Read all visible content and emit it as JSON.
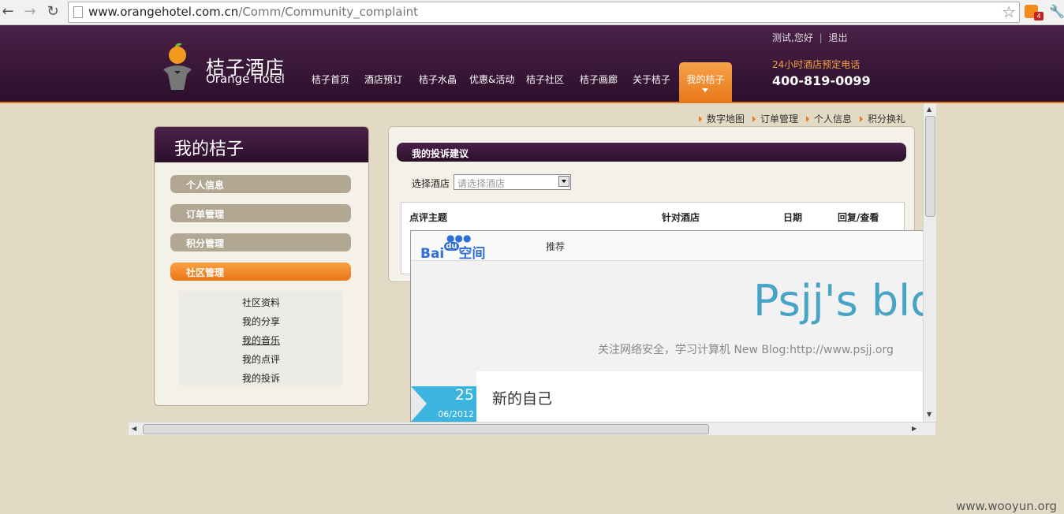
{
  "browser": {
    "url_domain": "www.orangehotel.com.cn",
    "url_path": "/Comm/Community_complaint",
    "rss_count": "4"
  },
  "header": {
    "logo_cn": "桔子酒店",
    "logo_en": "Orange Hotel",
    "nav": [
      "桔子首页",
      "酒店预订",
      "桔子水晶",
      "优惠&活动",
      "桔子社区",
      "桔子画廊",
      "关于桔子"
    ],
    "nav_active": "我的桔子",
    "user_greeting": "测试,您好",
    "logout": "退出",
    "hotline_label": "24小时酒店预定电话",
    "hotline": "400-819-0099"
  },
  "breadcrumbs": [
    "数字地图",
    "订单管理",
    "个人信息",
    "积分换礼"
  ],
  "sidebar": {
    "title": "我的桔子",
    "buttons": [
      "个人信息",
      "订单管理",
      "积分管理",
      "社区管理"
    ],
    "submenu": [
      "社区资料",
      "我的分享",
      "我的音乐",
      "我的点评",
      "我的投诉"
    ]
  },
  "main": {
    "title": "我的投诉建议",
    "hotel_label": "选择酒店",
    "hotel_placeholder": "请选择酒店",
    "columns": [
      "点评主题",
      "针对酒店",
      "日期",
      "回复/查看"
    ]
  },
  "iframe": {
    "logo_left": "Bai",
    "logo_du": "du",
    "logo_right": "空间",
    "recommend": "推荐",
    "blog_title": "Psjj's blog",
    "blog_subtitle": "关注网络安全，学习计算机 New Blog:http://www.psjj.org",
    "post_title": "新的自己",
    "post_day": "25",
    "post_month": "06/2012"
  },
  "watermark": "www.wooyun.org",
  "colors": {
    "header": "#3b1639",
    "accent": "#e8781a",
    "page_bg": "#e3dac6",
    "blog_title": "#48a4c6"
  }
}
